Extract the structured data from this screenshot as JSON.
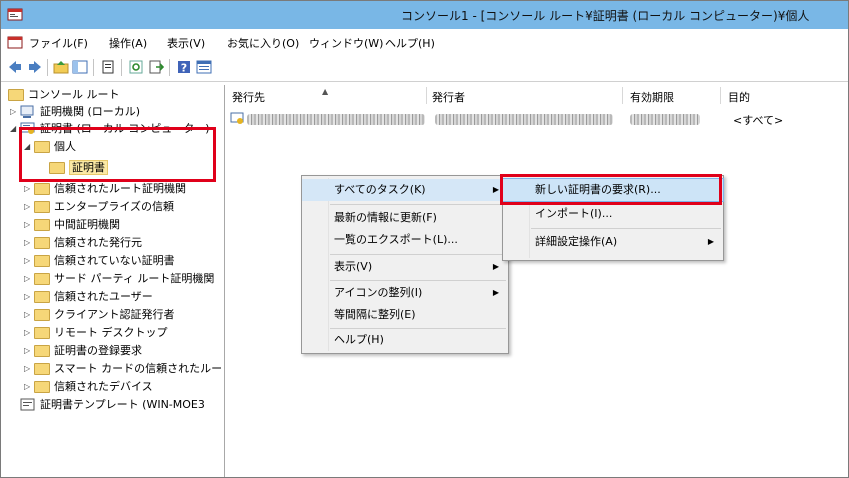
{
  "window": {
    "title": "コンソール1 - [コンソール ルート¥証明書 (ローカル コンピューター)¥個人"
  },
  "menubar": [
    "ファイル(F)",
    "操作(A)",
    "表示(V)",
    "お気に入り(O)",
    "ウィンドウ(W)",
    "ヘルプ(H)"
  ],
  "toolbar": [
    "back-icon",
    "forward-icon",
    "up-folder-icon",
    "show-hide-tree-icon",
    "properties-icon",
    "refresh-icon",
    "export-list-icon",
    "help-icon",
    "show-hide-action-pane-icon"
  ],
  "tree": {
    "root": "コンソール ルート",
    "items": [
      "証明機関 (ローカル)",
      "証明書 (ローカル コンピューター)",
      "個人",
      "証明書",
      "信頼されたルート証明機関",
      "エンタープライズの信頼",
      "中間証明機関",
      "信頼された発行元",
      "信頼されていない証明書",
      "サード パーティ ルート証明機関",
      "信頼されたユーザー",
      "クライアント認証発行者",
      "リモート デスクトップ",
      "証明書の登録要求",
      "スマート カードの信頼されたルート",
      "信頼されたデバイス",
      "証明書テンプレート (WIN-MOE3"
    ]
  },
  "list": {
    "columns": [
      "発行先",
      "発行者",
      "有効期限",
      "目的"
    ],
    "row": {
      "purpose": "<すべて>"
    }
  },
  "context_menu": {
    "items": [
      "すべてのタスク(K)",
      "最新の情報に更新(F)",
      "一覧のエクスポート(L)...",
      "表示(V)",
      "アイコンの整列(I)",
      "等間隔に整列(E)",
      "ヘルプ(H)"
    ]
  },
  "submenu": {
    "items": [
      "新しい証明書の要求(R)...",
      "インポート(I)...",
      "詳細設定操作(A)"
    ]
  },
  "colors": {
    "titlebar": "#79b7e6",
    "highlight_box": "#e0001a",
    "menu_bg": "#f0f0f0"
  }
}
